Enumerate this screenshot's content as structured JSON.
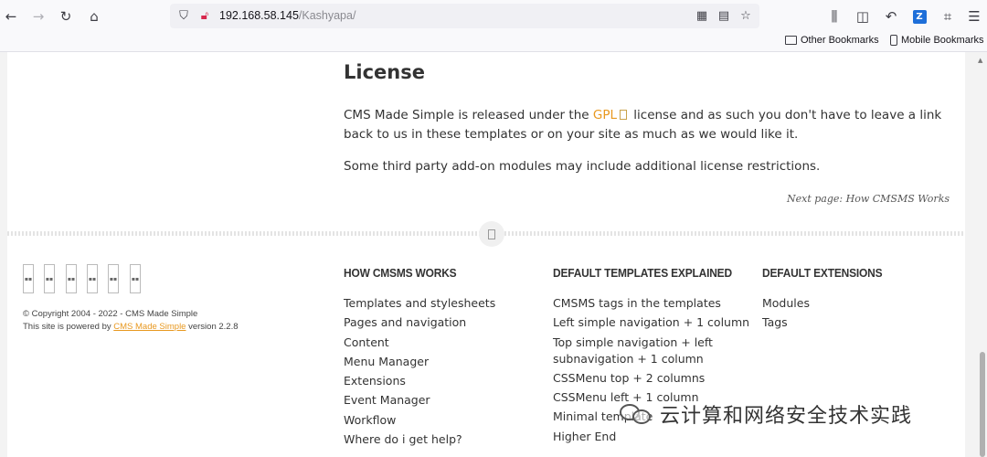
{
  "browser": {
    "url_host": "192.168.58.145",
    "url_path": "/Kashyapa/",
    "bookmarks": [
      {
        "label": "Other Bookmarks",
        "icon": "folder-icon"
      },
      {
        "label": "Mobile Bookmarks",
        "icon": "phone-icon"
      }
    ]
  },
  "page": {
    "section_title": "License",
    "license_para_before": "CMS Made Simple is released under the ",
    "license_link": "GPL",
    "license_para_after": " license and as such you don't have to leave a link back to us in these templates or on your site as much as we would like it.",
    "addon_para": "Some third party add-on modules may include additional license restrictions.",
    "next_page": "Next page: How CMSMS Works"
  },
  "footer": {
    "copyright_line": "© Copyright 2004 - 2022 - CMS Made Simple",
    "powered_before": "This site is powered by ",
    "powered_link": "CMS Made Simple",
    "powered_after": " version 2.2.8",
    "columns": [
      {
        "heading": "HOW CMSMS WORKS",
        "items": [
          "Templates and stylesheets",
          "Pages and navigation",
          "Content",
          "Menu Manager",
          "Extensions",
          "Event Manager",
          "Workflow",
          "Where do i get help?"
        ]
      },
      {
        "heading": "DEFAULT TEMPLATES EXPLAINED",
        "items": [
          "CMSMS tags in the templates",
          "Left simple navigation + 1 column",
          "Top simple navigation + left subnavigation + 1 column",
          "CSSMenu top + 2 columns",
          "CSSMenu left + 1 column",
          "Minimal template",
          "Higher End"
        ]
      },
      {
        "heading": "DEFAULT EXTENSIONS",
        "items": [
          "Modules",
          "Tags"
        ]
      }
    ]
  },
  "watermark": {
    "text": "云计算和网络安全技术实践"
  }
}
